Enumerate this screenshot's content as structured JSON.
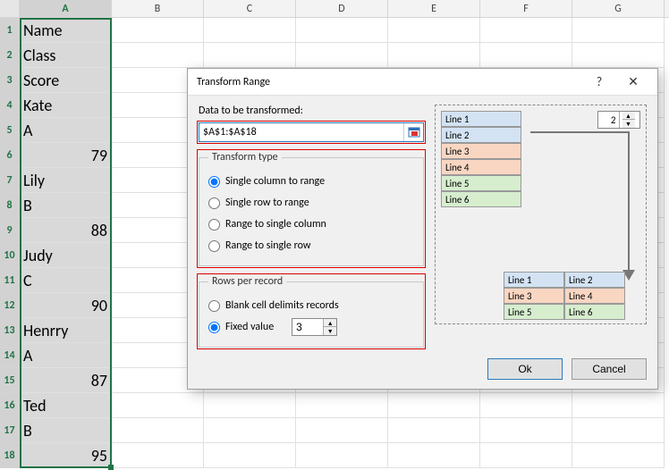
{
  "columns": [
    "A",
    "B",
    "C",
    "D",
    "E",
    "F",
    "G"
  ],
  "selected_column": "A",
  "cells": [
    "Name",
    "Class",
    "Score",
    "Kate",
    "A",
    "79",
    "Lily",
    "B",
    "88",
    "Judy",
    "C",
    "90",
    "Henrry",
    "A",
    "87",
    "Ted",
    "B",
    "95"
  ],
  "numeric_rows": [
    6,
    9,
    12,
    15,
    18
  ],
  "dialog": {
    "title": "Transform Range",
    "help_glyph": "?",
    "close_glyph": "✕",
    "data_label": "Data to be transformed:",
    "range_value": "$A$1:$A$18",
    "transform_legend": "Transform type",
    "radios": {
      "single_col": "Single column to range",
      "single_row": "Single row to range",
      "range_col": "Range to single column",
      "range_row": "Range to single row"
    },
    "rows_legend": "Rows per record",
    "rows_radios": {
      "blank": "Blank cell delimits records",
      "fixed": "Fixed value"
    },
    "fixed_value": "3",
    "preview_count": "2",
    "preview_lines": [
      "Line 1",
      "Line 2",
      "Line 3",
      "Line 4",
      "Line 5",
      "Line 6"
    ],
    "ok": "Ok",
    "cancel": "Cancel"
  }
}
